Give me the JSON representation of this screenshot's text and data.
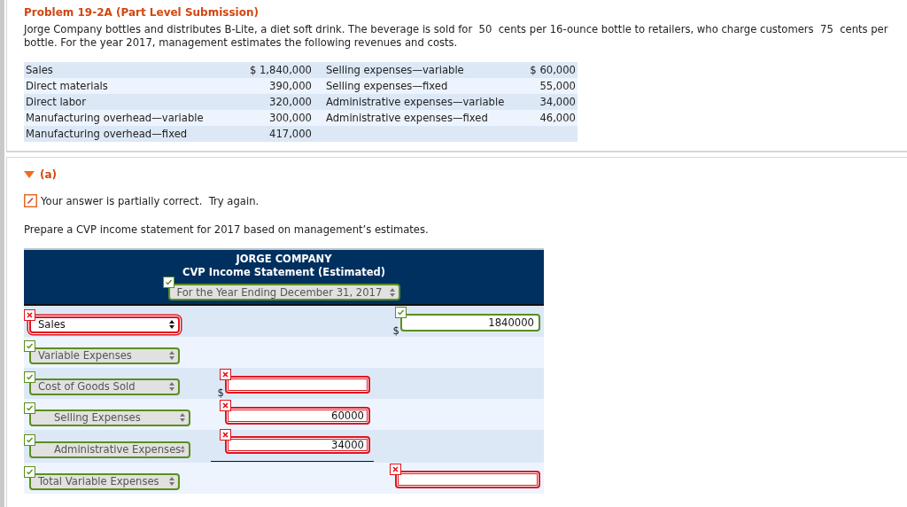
{
  "problem": {
    "title": "Problem 19-2A (Part Level Submission)",
    "text": "Jorge Company bottles and distributes B-Lite, a diet soft drink. The beverage is sold for  50  cents per 16-ounce bottle to retailers, who charge customers  75  cents per bottle. For the year 2017, management estimates the following revenues and costs."
  },
  "data_table": [
    {
      "label_1": "Sales",
      "value_1": "$ 1,840,000",
      "label_2": "Selling expenses—variable",
      "value_2": "$ 60,000"
    },
    {
      "label_1": "Direct materials",
      "value_1": "390,000",
      "label_2": "Selling expenses—fixed",
      "value_2": "55,000"
    },
    {
      "label_1": "Direct labor",
      "value_1": "320,000",
      "label_2": "Administrative expenses—variable",
      "value_2": "34,000"
    },
    {
      "label_1": "Manufacturing overhead—variable",
      "value_1": "300,000",
      "label_2": "Administrative expenses—fixed",
      "value_2": "46,000"
    },
    {
      "label_1": "Manufacturing overhead—fixed",
      "value_1": "417,000"
    }
  ],
  "part": {
    "label": "(a)",
    "expanded": true,
    "feedback": "Your answer is partially correct.  Try again.",
    "prompt": "Prepare a CVP income statement for 2017 based on management’s estimates."
  },
  "statement": {
    "company": "JORGE COMPANY",
    "title": "CVP Income Statement (Estimated)",
    "period": {
      "value": "For the Year Ending December 31, 2017",
      "correct": true
    },
    "rows": [
      {
        "label": "Sales",
        "correct": false,
        "indent": false,
        "amount_2": {
          "currency": "$",
          "value": "1840000",
          "correct": true
        }
      },
      {
        "label": "Variable Expenses",
        "correct": true,
        "indent": false
      },
      {
        "label": "Cost of Goods Sold",
        "correct": true,
        "indent": false,
        "amount_1": {
          "currency": "$",
          "correct": false
        }
      },
      {
        "label": "Selling Expenses",
        "correct": true,
        "indent": true,
        "amount_1": {
          "value": "60000",
          "correct": false
        }
      },
      {
        "label": "Administrative Expenses",
        "correct": true,
        "indent": true,
        "amount_1": {
          "value": "34000",
          "correct": false,
          "underline": true
        }
      },
      {
        "label": "Total Variable Expenses",
        "correct": true,
        "indent": false,
        "amount_2": {
          "correct": false
        }
      }
    ]
  }
}
